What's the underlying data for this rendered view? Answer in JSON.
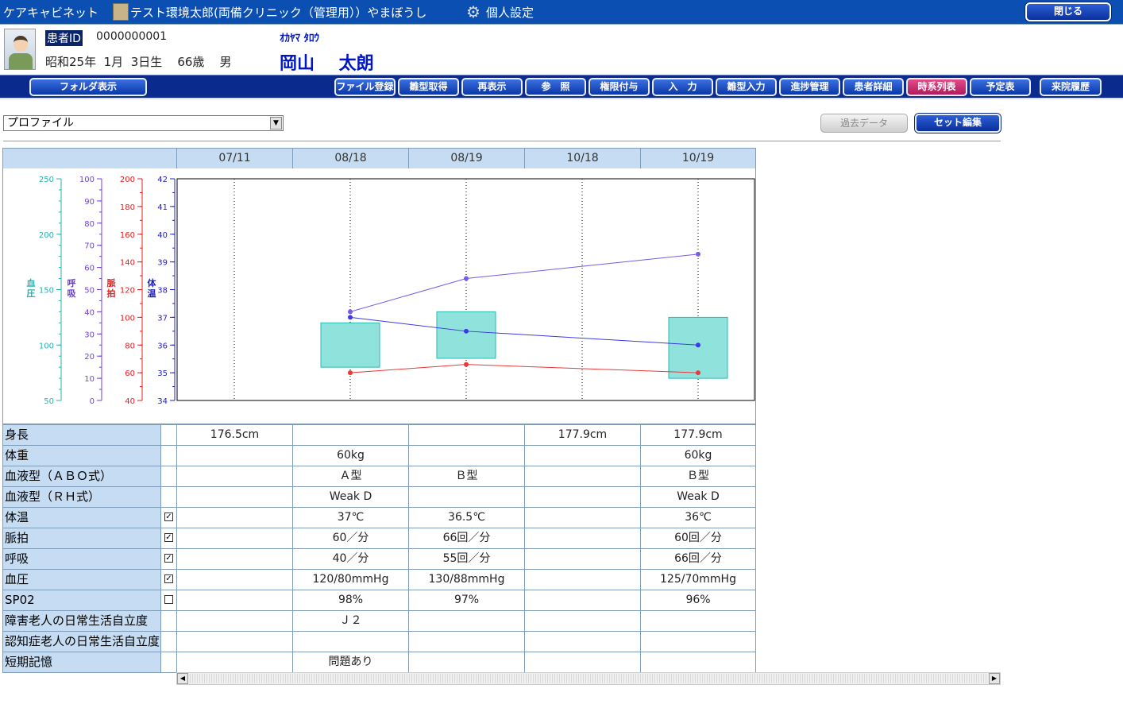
{
  "app": {
    "name": "ケアキャビネット",
    "user": "テスト環境太郎(両備クリニック（管理用））やまぼうし",
    "settings_label": "個人設定",
    "close_label": "閉じる"
  },
  "patient": {
    "id_label": "患者ID",
    "id_value": "0000000001",
    "dob": "昭和25年  1月  3日生    66歳    男",
    "kana": "ｵｶﾔﾏ  ﾀﾛｳ",
    "name": "岡山    太朗"
  },
  "nav": {
    "folder": "フォルダ表示",
    "items": [
      "ファイル登録",
      "雛型取得",
      "再表示",
      "参　照",
      "権限付与",
      "入　力",
      "雛型入力",
      "進捗管理",
      "患者詳細",
      "時系列表",
      "予定表",
      "来院履歴"
    ],
    "active": "時系列表"
  },
  "toolbar": {
    "select_value": "プロファイル",
    "past_label": "過去データ",
    "set_label": "セット編集"
  },
  "dates": [
    "07/11",
    "08/18",
    "08/19",
    "10/18",
    "10/19"
  ],
  "chart_data": {
    "type": "line",
    "categories": [
      "07/11",
      "08/18",
      "08/19",
      "10/18",
      "10/19"
    ],
    "axes": [
      {
        "label": "血圧",
        "color": "#2ab0b0",
        "min": 50,
        "max": 250,
        "ticks": [
          50,
          100,
          150,
          200,
          250
        ]
      },
      {
        "label": "呼吸",
        "color": "#7040d8",
        "min": 0,
        "max": 100,
        "ticks": [
          0,
          10,
          20,
          30,
          40,
          50,
          60,
          70,
          80,
          90,
          100
        ]
      },
      {
        "label": "脈拍",
        "color": "#e02020",
        "min": 40,
        "max": 200,
        "ticks": [
          40,
          60,
          80,
          100,
          120,
          140,
          160,
          180,
          200
        ]
      },
      {
        "label": "体温",
        "color": "#2020c0",
        "min": 34,
        "max": 42,
        "ticks": [
          34,
          35,
          36,
          37,
          38,
          39,
          40,
          41,
          42
        ]
      }
    ],
    "series": [
      {
        "name": "体温",
        "axis": 3,
        "color": "#3a3ae6",
        "values": [
          null,
          37,
          36.5,
          null,
          36
        ]
      },
      {
        "name": "脈拍",
        "axis": 2,
        "color": "#e83a3a",
        "values": [
          null,
          60,
          66,
          null,
          60
        ]
      },
      {
        "name": "呼吸",
        "axis": 1,
        "color": "#7a5ae8",
        "values": [
          null,
          40,
          55,
          null,
          66
        ]
      }
    ],
    "bp": {
      "name": "血圧",
      "color": "#2ab8b0",
      "fill": "#8fe3dc",
      "values": [
        null,
        [
          80,
          120
        ],
        [
          88,
          130
        ],
        null,
        [
          70,
          125
        ]
      ]
    }
  },
  "rows": [
    {
      "label": "身長",
      "check": null,
      "values": [
        "176.5cm",
        "",
        "",
        "177.9cm",
        "177.9cm"
      ]
    },
    {
      "label": "体重",
      "check": null,
      "values": [
        "",
        "60kg",
        "",
        "",
        "60kg"
      ]
    },
    {
      "label": "血液型（ＡＢＯ式）",
      "check": null,
      "values": [
        "",
        "Ａ型",
        "Ｂ型",
        "",
        "Ｂ型"
      ]
    },
    {
      "label": "血液型（ＲＨ式）",
      "check": null,
      "values": [
        "",
        "Weak D",
        "",
        "",
        "Weak D"
      ]
    },
    {
      "label": "体温",
      "check": "✓",
      "values": [
        "",
        "37℃",
        "36.5℃",
        "",
        "36℃"
      ]
    },
    {
      "label": "脈拍",
      "check": "✓",
      "values": [
        "",
        "60／分",
        "66回／分",
        "",
        "60回／分"
      ]
    },
    {
      "label": "呼吸",
      "check": "✓",
      "values": [
        "",
        "40／分",
        "55回／分",
        "",
        "66回／分"
      ]
    },
    {
      "label": "血圧",
      "check": "✓",
      "values": [
        "",
        "120/80mmHg",
        "130/88mmHg",
        "",
        "125/70mmHg"
      ]
    },
    {
      "label": "SP02",
      "check": "",
      "values": [
        "",
        "98%",
        "97%",
        "",
        "96%"
      ]
    },
    {
      "label": "障害老人の日常生活自立度",
      "check": null,
      "values": [
        "",
        "Ｊ２",
        "",
        "",
        ""
      ]
    },
    {
      "label": "認知症老人の日常生活自立度",
      "check": null,
      "values": [
        "",
        "",
        "",
        "",
        ""
      ]
    },
    {
      "label": "短期記憶",
      "check": null,
      "values": [
        "",
        "問題あり",
        "",
        "",
        ""
      ]
    }
  ]
}
